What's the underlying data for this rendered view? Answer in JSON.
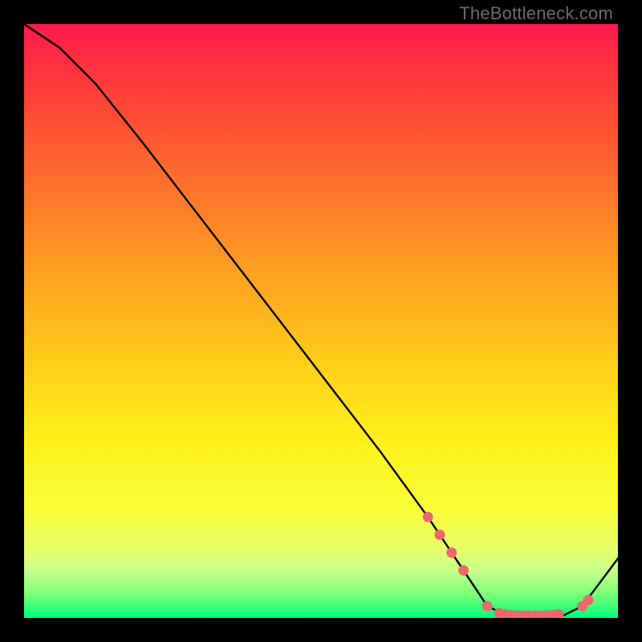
{
  "watermark": "TheBottleneck.com",
  "chart_data": {
    "type": "line",
    "title": "",
    "xlabel": "",
    "ylabel": "",
    "xlim": [
      0,
      100
    ],
    "ylim": [
      0,
      100
    ],
    "series": [
      {
        "name": "bottleneck-curve",
        "x": [
          0,
          6,
          12,
          20,
          30,
          40,
          50,
          60,
          68,
          74,
          78,
          82,
          86,
          90,
          94,
          100
        ],
        "y": [
          100,
          96,
          90,
          80,
          67,
          54,
          41,
          28,
          17,
          8,
          2,
          0,
          0,
          0,
          2,
          10
        ]
      }
    ],
    "markers": {
      "name": "highlight-dots",
      "color": "#ea6a6a",
      "x": [
        68,
        70,
        72,
        74,
        78,
        80,
        81,
        82,
        83,
        84,
        85,
        86,
        87,
        88,
        89,
        90,
        94,
        95
      ],
      "y": [
        17,
        14,
        11,
        8,
        2,
        0.8,
        0.6,
        0.5,
        0.4,
        0.4,
        0.4,
        0.4,
        0.4,
        0.4,
        0.5,
        0.6,
        2,
        3
      ]
    }
  }
}
